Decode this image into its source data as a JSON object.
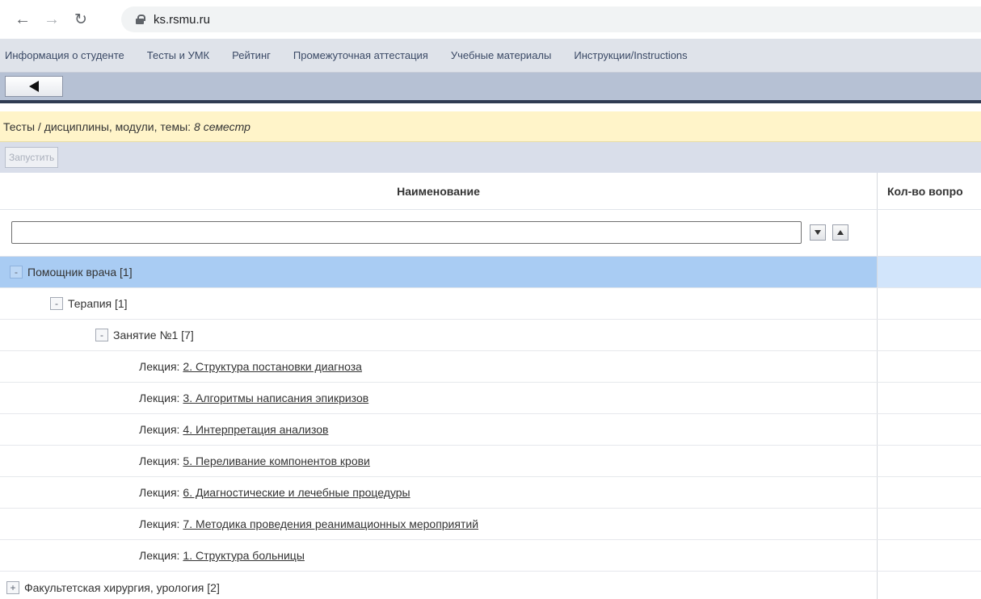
{
  "browser": {
    "url": "ks.rsmu.ru",
    "back_icon": "arrow-left-icon",
    "forward_icon": "arrow-right-icon",
    "reload_icon": "reload-icon"
  },
  "menu": {
    "items": [
      "Информация о студенте",
      "Тесты и УМК",
      "Рейтинг",
      "Промежуточная аттестация",
      "Учебные материалы",
      "Инструкции/Instructions"
    ]
  },
  "breadcrumb": {
    "path": "Тесты / дисциплины, модули, темы:",
    "semester": "8 семестр"
  },
  "actions": {
    "run_label": "Запустить"
  },
  "table": {
    "col_name": "Наименование",
    "col_count": "Кол-во вопро",
    "filter_value": "",
    "tree": [
      {
        "toggle": "-",
        "label": "Помощник врача [1]",
        "selected": true
      },
      {
        "toggle": "-",
        "label": "Терапия [1]"
      },
      {
        "toggle": "-",
        "label": "Занятие №1 [7]"
      }
    ],
    "lecture_prefix": "Лекция:",
    "lectures": [
      "2. Структура постановки диагноза",
      "3. Алгоритмы написания эпикризов",
      "4. Интерпретация анализов",
      "5. Переливание компонентов крови",
      "6. Диагностические и лечебные процедуры",
      "7. Методика проведения реанимационных мероприятий",
      "1. Структура больницы"
    ],
    "collapsed_node": {
      "toggle": "+",
      "label": "Факультетская хирургия, урология [2]"
    }
  },
  "colors": {
    "selected_row": "#a9ccf3",
    "breadcrumb_bg": "#fff4c9",
    "toolbar_bg": "#b6c1d4"
  }
}
